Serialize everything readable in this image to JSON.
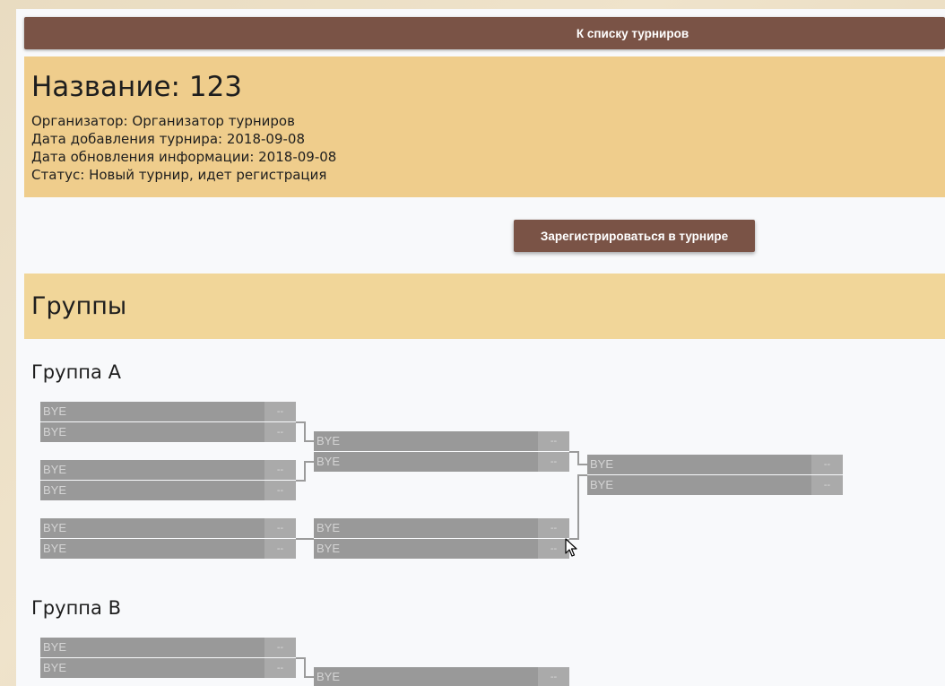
{
  "nav": {
    "back_label": "К списку турниров"
  },
  "tournament": {
    "title": "Название: 123",
    "organizer": "Организатор: Организатор турниров",
    "date_added": "Дата добавления турнира: 2018-09-08",
    "date_updated": "Дата обновления информации: 2018-09-08",
    "status": "Статус: Новый турнир, идет регистрация"
  },
  "register_button_label": "Зарегистрироваться в турнире",
  "groups_heading": "Группы",
  "groups": [
    {
      "title": "Группа A",
      "matches": [
        {
          "teams": [
            {
              "name": "BYE",
              "score": "--"
            },
            {
              "name": "BYE",
              "score": "--"
            }
          ]
        },
        {
          "teams": [
            {
              "name": "BYE",
              "score": "--"
            },
            {
              "name": "BYE",
              "score": "--"
            }
          ]
        },
        {
          "teams": [
            {
              "name": "BYE",
              "score": "--"
            },
            {
              "name": "BYE",
              "score": "--"
            }
          ]
        },
        {
          "teams": [
            {
              "name": "BYE",
              "score": "--"
            },
            {
              "name": "BYE",
              "score": "--"
            }
          ]
        },
        {
          "teams": [
            {
              "name": "BYE",
              "score": "--"
            },
            {
              "name": "BYE",
              "score": "--"
            }
          ]
        },
        {
          "teams": [
            {
              "name": "BYE",
              "score": "--"
            },
            {
              "name": "BYE",
              "score": "--"
            }
          ]
        }
      ]
    },
    {
      "title": "Группа B",
      "matches": [
        {
          "teams": [
            {
              "name": "BYE",
              "score": "--"
            },
            {
              "name": "BYE",
              "score": "--"
            }
          ]
        },
        {
          "teams": [
            {
              "name": "BYE",
              "score": "--"
            }
          ]
        }
      ]
    }
  ],
  "colors": {
    "button_brown": "#7a5346",
    "info_panel": "#efcd8c",
    "groups_panel": "#f1d699",
    "team_bg": "#999999",
    "score_bg": "#aaaaaa"
  }
}
